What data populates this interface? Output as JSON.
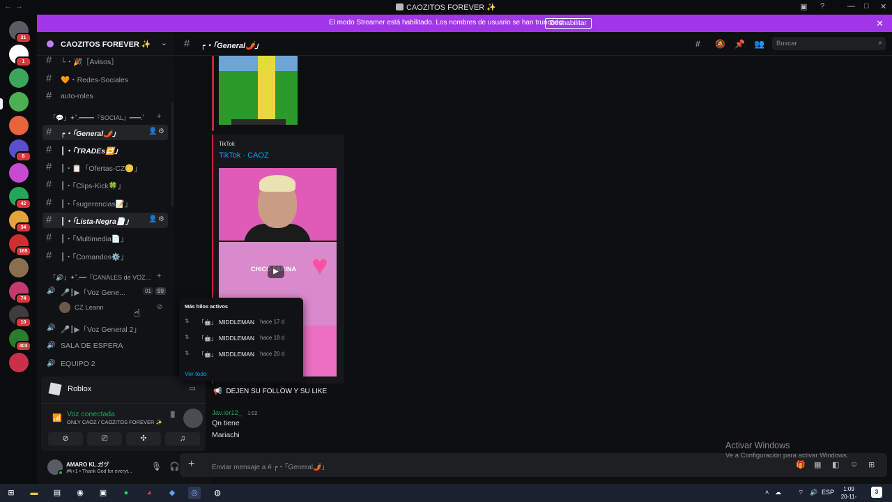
{
  "window": {
    "title": "CAOZITOS FOREVER ✨"
  },
  "banner": {
    "message": "El modo Streamer está habilitado. Los nombres de usuario se han truncado.",
    "button": "Deshabilitar"
  },
  "servers": [
    {
      "badge": "21"
    },
    {
      "badge": "1"
    },
    {
      "badge": ""
    },
    {
      "badge": ""
    },
    {
      "badge": ""
    },
    {
      "badge": "8"
    },
    {
      "badge": ""
    },
    {
      "badge": "42"
    },
    {
      "badge": "34"
    },
    {
      "badge": "165"
    },
    {
      "badge": ""
    },
    {
      "badge": "74"
    },
    {
      "badge": "10"
    },
    {
      "badge": "403"
    },
    {
      "badge": ""
    }
  ],
  "guild": {
    "name": "CAOZITOS FOREVER ✨"
  },
  "channels": [
    {
      "name": "└・🎉［Avisos］",
      "bold": false
    },
    {
      "name": "🧡・Redes-Sociales",
      "bold": false
    },
    {
      "name": "auto-roles",
      "bold": false
    },
    {
      "name": "┍・「General🌶️」",
      "bold": true
    },
    {
      "name": "┃・「TRADEs🔁」",
      "bold": true
    },
    {
      "name": "┃・📋「Ofertas-CZ🪙」",
      "bold": false
    },
    {
      "name": "┃・「Clips-Kick🍀」",
      "bold": false
    },
    {
      "name": "┃・「sugerencias📝」",
      "bold": false
    },
    {
      "name": "┃・「Lista-Negra📄」",
      "bold": true
    },
    {
      "name": "┃・「Multimedia📄」",
      "bold": false
    },
    {
      "name": "┃・「Comandos⚙️」",
      "bold": false
    }
  ],
  "categories": {
    "social": "「💬」✦˚.━━━━『SOCIAL』━━━.˚",
    "voice": "「🔊」✦˚.━━『CANALES de VOZ..."
  },
  "voice_channels": [
    {
      "name": "🎤┇▶「Voz Gene...",
      "count": "01",
      "limit": "99"
    },
    {
      "name": "🎤┇▶「Voz General 2」"
    },
    {
      "name": "SALA DE ESPERA"
    },
    {
      "name": "EQUIPO 2"
    }
  ],
  "voice_user": "CZ Leann",
  "activity": {
    "game": "Roblox",
    "status": "Voz conectada",
    "location": "ONLY CAOZ / CAOZITOS FOREVER ✨"
  },
  "user": {
    "name": "AMARO KL.ガヅ",
    "status": "🎮+1 • Thank God for everyt..."
  },
  "chat": {
    "channel": "┍・「General🌶️」",
    "search_placeholder": "Buscar"
  },
  "embed": {
    "provider": "TikTok",
    "title": "TikTok · CAOZ",
    "thumb2_text": "CHICO FARINA"
  },
  "threads": {
    "title": "Más hilos activos",
    "items": [
      {
        "tag": "「🤖」",
        "author": "MIDDLEMAN",
        "time": "hace 17 d"
      },
      {
        "tag": "「🤖」",
        "author": "MIDDLEMAN",
        "time": "hace 18 d"
      },
      {
        "tag": "「🤖」",
        "author": "MIDDLEMAN",
        "time": "hace 20 d"
      }
    ],
    "more": "Ver todo"
  },
  "follow_text": "DEJEN SU FOLLOW Y SU LIKE",
  "message": {
    "author": "Jav.ier12_",
    "time": "1:02",
    "lines": [
      "Qn tiene",
      "Mariachi"
    ]
  },
  "composer": {
    "placeholder": "Enviar mensaje a # ┍・「General🌶️」"
  },
  "watermark": {
    "title": "Activar Windows",
    "subtitle": "Ve a Configuración para activar Windows."
  },
  "taskbar": {
    "lang": "ESP",
    "time": "1:09",
    "date": "20-11-2025",
    "notifications": "3"
  },
  "colors": {
    "accent": "#a036e8",
    "online": "#23a55a",
    "link": "#00a8fc",
    "bg": "#0e0f11"
  }
}
